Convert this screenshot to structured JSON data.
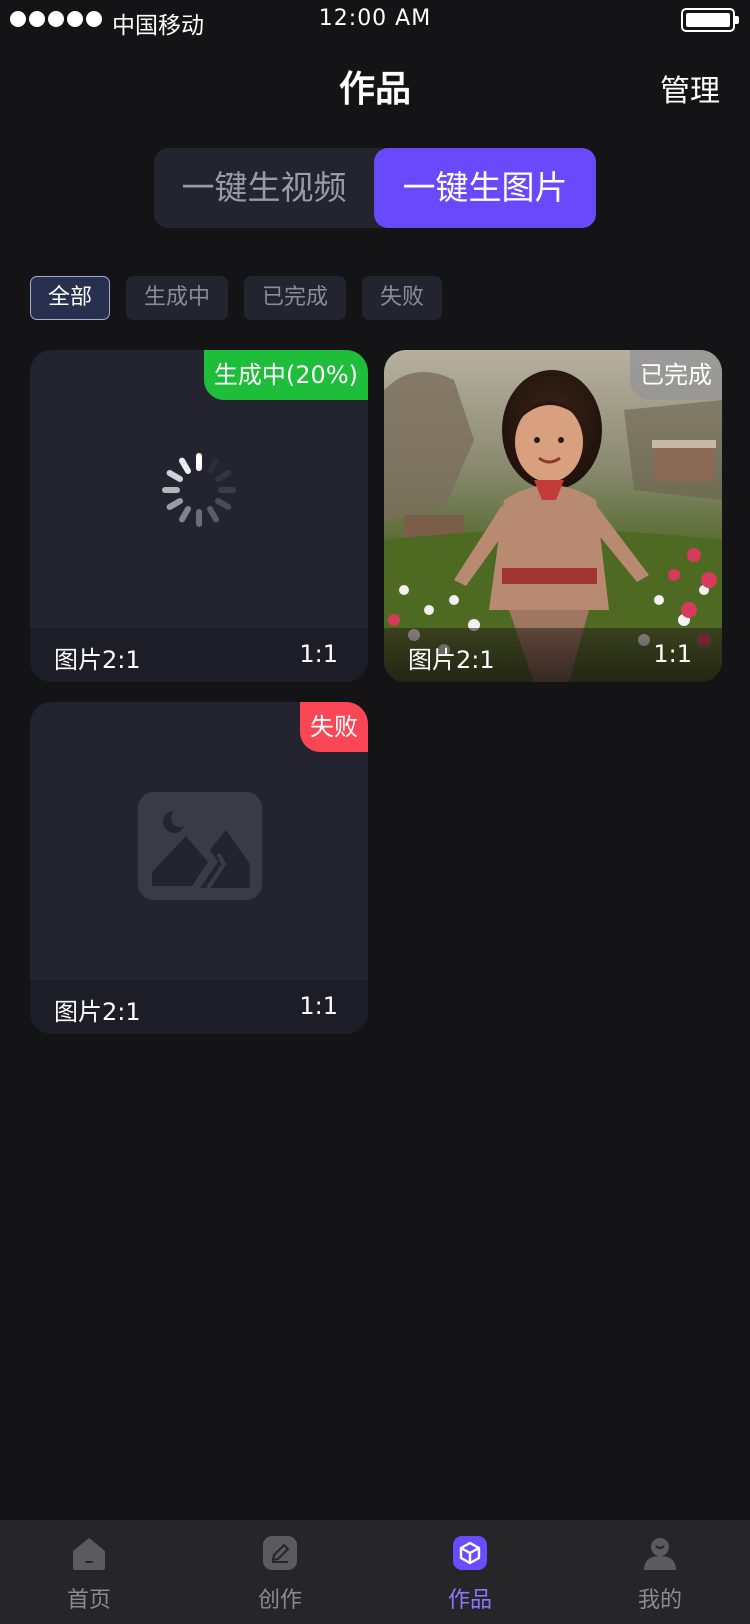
{
  "status_bar": {
    "carrier": "中国移动",
    "time": "12:00 AM"
  },
  "header": {
    "title": "作品",
    "manage": "管理"
  },
  "segments": [
    {
      "label": "一键生视频",
      "active": false
    },
    {
      "label": "一键生图片",
      "active": true
    }
  ],
  "filters": [
    {
      "label": "全部",
      "active": true
    },
    {
      "label": "生成中",
      "active": false
    },
    {
      "label": "已完成",
      "active": false
    },
    {
      "label": "失败",
      "active": false
    }
  ],
  "cards": [
    {
      "status": "生成中(20%)",
      "status_color": "#1fbe3a",
      "title": "图片2:1",
      "ratio": "1:1",
      "content": "loading-spinner"
    },
    {
      "status": "已完成",
      "status_color": "#969696",
      "title": "图片2:1",
      "ratio": "1:1",
      "content": "generated-photo"
    },
    {
      "status": "失败",
      "status_color": "#fb4655",
      "title": "图片2:1",
      "ratio": "1:1",
      "content": "image-placeholder-icon"
    }
  ],
  "tabbar": [
    {
      "label": "首页",
      "icon": "home-icon",
      "active": false
    },
    {
      "label": "创作",
      "icon": "edit-icon",
      "active": false
    },
    {
      "label": "作品",
      "icon": "cube-icon",
      "active": true
    },
    {
      "label": "我的",
      "icon": "user-icon",
      "active": false
    }
  ],
  "colors": {
    "accent": "#6849fb",
    "background": "#141416",
    "card": "#23242f"
  }
}
